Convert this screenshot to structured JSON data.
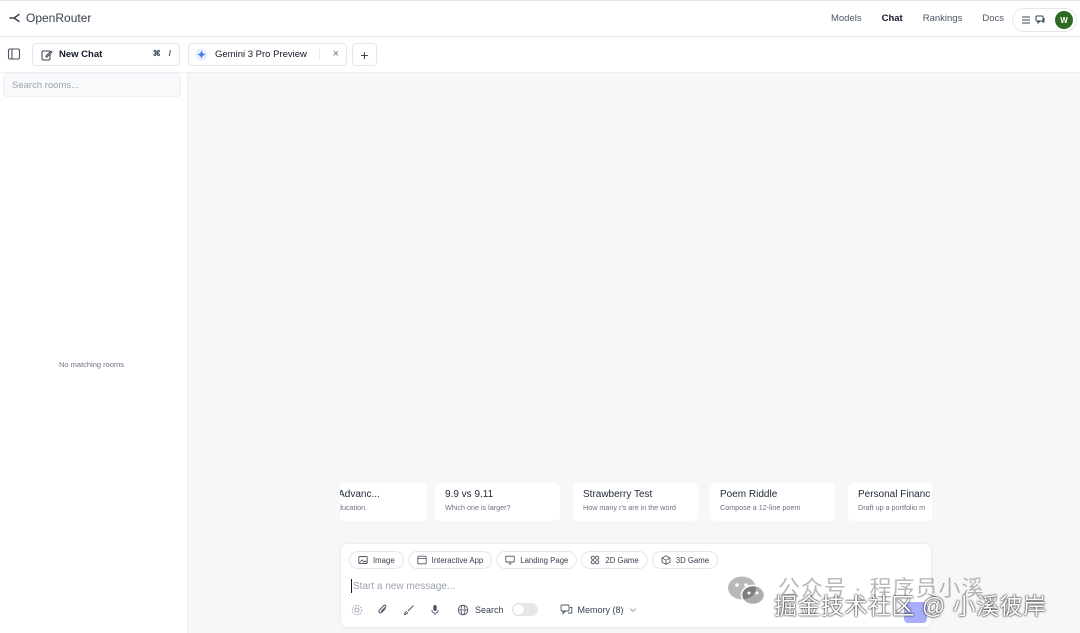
{
  "header": {
    "brand": "OpenRouter",
    "nav": [
      "Models",
      "Chat",
      "Rankings",
      "Docs"
    ],
    "avatar_initial": "W",
    "avatar_color": "#2d6a1f"
  },
  "tabs": {
    "new_chat_label": "New Chat",
    "shortcut_keys": [
      "⌘",
      "/"
    ],
    "model_tab_label": "Gemini 3 Pro Preview",
    "close_glyph": "×",
    "add_glyph": "+"
  },
  "sidebar": {
    "search_placeholder": "Search rooms...",
    "empty_message": "No matching rooms"
  },
  "suggestions": [
    {
      "title": "tional Advanc...",
      "desc": "higher education."
    },
    {
      "title": "9.9 vs 9.11",
      "desc": "Which one is larger?"
    },
    {
      "title": "Strawberry Test",
      "desc": "How many r's are in the word"
    },
    {
      "title": "Poem Riddle",
      "desc": "Compose a 12-line poem"
    },
    {
      "title": "Personal Financ",
      "desc": "Draft up a portfolio m"
    }
  ],
  "composer": {
    "chips": [
      {
        "label": "Image",
        "icon": "image-icon"
      },
      {
        "label": "Interactive App",
        "icon": "app-icon"
      },
      {
        "label": "Landing Page",
        "icon": "monitor-icon"
      },
      {
        "label": "2D Game",
        "icon": "grid-icon"
      },
      {
        "label": "3D Game",
        "icon": "cube-icon"
      }
    ],
    "placeholder": "Start a new message...",
    "search_label": "Search",
    "memory_label": "Memory (8)",
    "send_color": "#a8aefc"
  },
  "watermark": {
    "line1": "公众号 · 程序员小溪",
    "line2": "掘金技术社区 @ 小溪彼岸"
  }
}
